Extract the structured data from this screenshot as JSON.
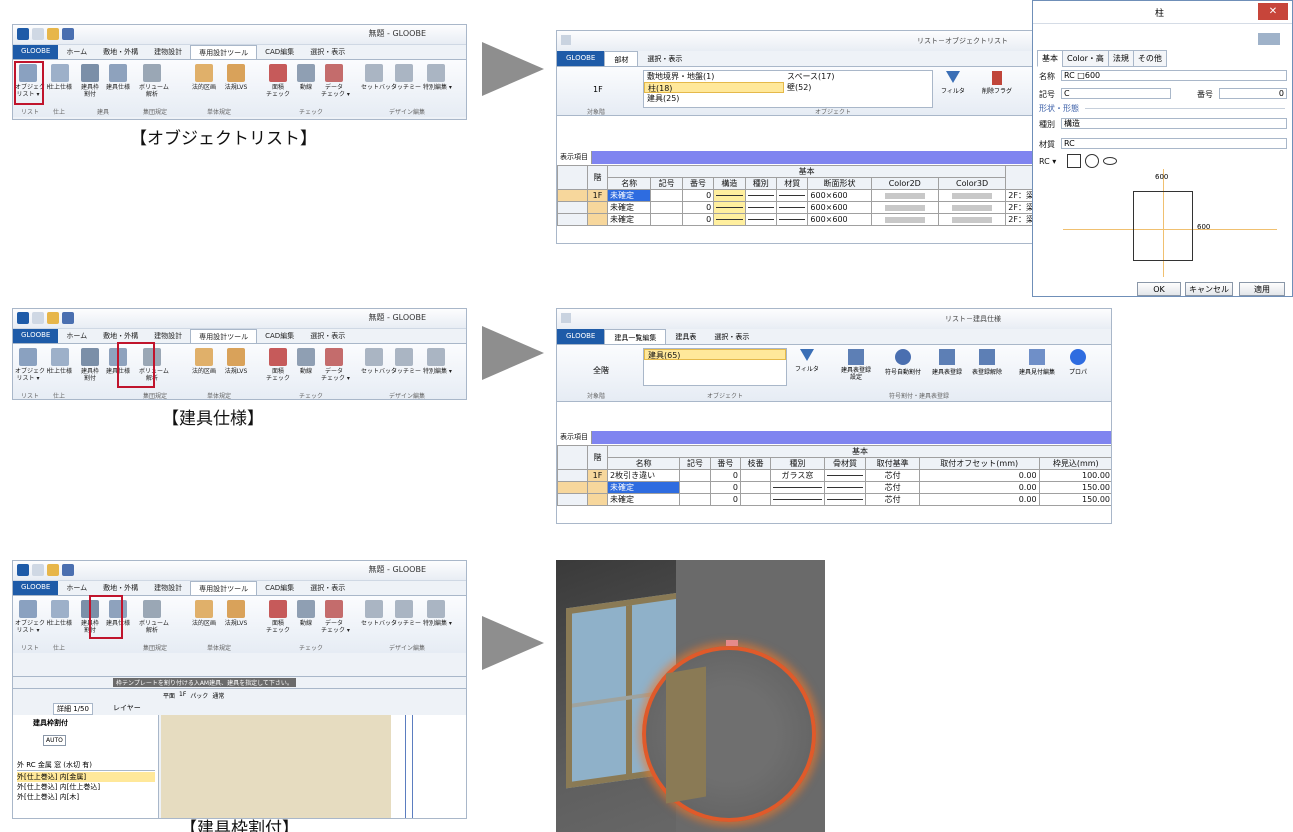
{
  "ribbon": {
    "window_title": "無題 - GLOOBE",
    "tabs": [
      "GLOOBE",
      "ホーム",
      "敷地・外構",
      "建物設計",
      "専用設計ツール",
      "CAD編集",
      "選択・表示"
    ],
    "buttons": [
      "オブジェクト\nリスト ▾",
      "仕上仕様",
      "建具枠\n割付",
      "建具仕様",
      "ボリューム\n解析",
      "法的区画",
      "法規LVS",
      "面積\nチェック",
      "動線",
      "データ\nチェック ▾",
      "セットバック",
      "タッチミー",
      "特別編集 ▾"
    ],
    "groups": [
      "リスト",
      "仕上",
      "建具",
      "集団規定",
      "単体規定",
      "チェック",
      "デザイン編集"
    ]
  },
  "captions": {
    "object_list": "【オブジェクトリスト】",
    "fitting_spec": "【建具仕様】",
    "frame_alloc": "【建具枠割付】"
  },
  "list1": {
    "title": "リスト－オブジェクトリスト",
    "tabs": [
      "GLOOBE",
      "部材",
      "選択・表示"
    ],
    "floor": "1F",
    "floor_label": "対象階",
    "objects_col1": [
      "敷地境界・地盤(1)",
      "柱(18)",
      "建具(25)"
    ],
    "objects_col2": [
      "スペース(17)",
      "壁(52)"
    ],
    "object_label": "オブジェクト",
    "filter": "フィルタ",
    "delete_flag": "削除フラグ",
    "display_items": "表示項目",
    "group_header": "基本",
    "columns": [
      "階",
      "名称",
      "記号",
      "番号",
      "構造",
      "種別",
      "材質",
      "断面形状",
      "Color2D",
      "Color3D"
    ],
    "rows": [
      {
        "floor": "1F",
        "name": "未確定",
        "number": "0",
        "shape": "600×600",
        "note": "2F：梁"
      },
      {
        "floor": "",
        "name": "未確定",
        "number": "0",
        "shape": "600×600",
        "note": "2F：梁"
      },
      {
        "floor": "",
        "name": "未確定",
        "number": "0",
        "shape": "600×600",
        "note": "2F：梁"
      }
    ]
  },
  "dialog": {
    "title": "柱",
    "tabs": [
      "基本",
      "Color・高",
      "法規",
      "その他"
    ],
    "name_label": "名称",
    "name_value": "RC □600",
    "symbol_label": "記号",
    "symbol_value": "C",
    "number_label": "番号",
    "number_value": "0",
    "section_label": "形状・形態",
    "kind_label": "種別",
    "kind_value": "構造",
    "material_label": "材質",
    "material_value": "RC",
    "rc_label": "RC ▾",
    "dim_w": "600",
    "dim_h": "600",
    "ok": "OK",
    "cancel": "キャンセル",
    "apply": "適用"
  },
  "list2": {
    "title": "リスト－建具仕様",
    "tabs": [
      "GLOOBE",
      "建具一覧編集",
      "建具表",
      "選択・表示"
    ],
    "floor": "全階",
    "floor_label": "対象階",
    "objects": [
      "建具(65)"
    ],
    "object_label": "オブジェクト",
    "filter": "フィルタ",
    "buttons": [
      "建具表登録\n設定",
      "符号自動割付",
      "建具表登録",
      "表登録解除",
      "建具見付編集",
      "プロパ"
    ],
    "group_label": "符号割付・建具表登録",
    "display_items": "表示項目",
    "group_header": "基本",
    "columns": [
      "階",
      "名称",
      "記号",
      "番号",
      "枝番",
      "種別",
      "骨材質",
      "取付基準",
      "取付オフセット(mm)",
      "枠見込(mm)"
    ],
    "rows": [
      {
        "floor": "1F",
        "name": "2枚引き違い",
        "number": "0",
        "kind": "ガラス窓",
        "base": "芯付",
        "offset": "0.00",
        "frame": "100.00"
      },
      {
        "floor": "",
        "name": "未確定",
        "number": "0",
        "kind": "",
        "base": "芯付",
        "offset": "0.00",
        "frame": "150.00"
      },
      {
        "floor": "",
        "name": "未確定",
        "number": "0",
        "kind": "",
        "base": "芯付",
        "offset": "0.00",
        "frame": "150.00"
      }
    ]
  },
  "cad": {
    "toolbar_text": "枠テンプレートを割り付ける入AM建具、建具を指定して下さい。",
    "scale": "詳細 1/50",
    "layer": "レイヤー",
    "panel_title": "建具枠割付",
    "auto": "AUTO",
    "filter_text": "外 RC 金属 窓 (水切 有)",
    "items": [
      "外[仕上巻込] 内[金属]",
      "外[仕上巻込] 内[仕上巻込]",
      "外[仕上巻込] 内[木]"
    ],
    "view_tabs": [
      "平面",
      "1F",
      "パック",
      "通常"
    ]
  }
}
